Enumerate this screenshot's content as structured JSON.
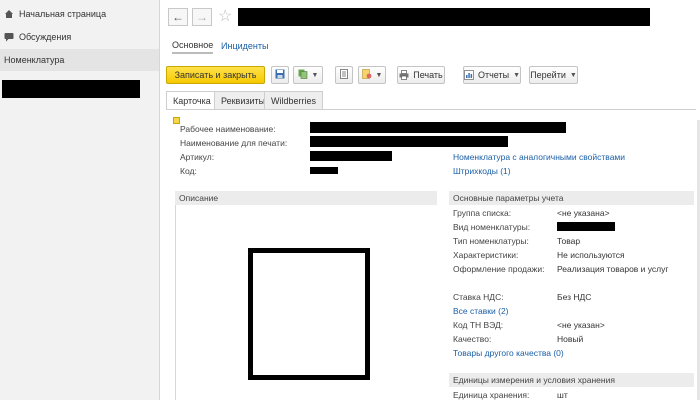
{
  "sidebar": {
    "items": [
      {
        "label": "Начальная страница",
        "icon": "home-icon"
      },
      {
        "label": "Обсуждения",
        "icon": "chat-icon"
      },
      {
        "label": "Номенклатура",
        "icon": ""
      }
    ]
  },
  "header": {
    "back_icon": "arrow-left-icon",
    "forward_icon": "arrow-right-icon",
    "favorite_icon": "star-icon"
  },
  "section_tabs": [
    "Основное",
    "Инциденты"
  ],
  "toolbar": {
    "save_close": "Записать и закрыть",
    "print": "Печать",
    "reports": "Отчеты",
    "goto": "Перейти"
  },
  "form_tabs": [
    "Карточка",
    "Реквизиты",
    "Wildberries"
  ],
  "fields": {
    "work_name": "Рабочее наименование:",
    "print_name": "Наименование для печати:",
    "article": "Артикул:",
    "code": "Код:",
    "analog_link": "Номенклатура с аналогичными свойствами",
    "barcodes_link": "Штрихкоды (1)"
  },
  "description": {
    "header": "Описание"
  },
  "accounting": {
    "header": "Основные параметры учета",
    "rows": [
      {
        "label": "Группа списка:",
        "value": "<не указана>"
      },
      {
        "label": "Вид номенклатуры:",
        "value": ""
      },
      {
        "label": "Тип номенклатуры:",
        "value": "Товар"
      },
      {
        "label": "Характеристики:",
        "value": "Не используются"
      },
      {
        "label": "Оформление продажи:",
        "value": "Реализация товаров и услуг"
      }
    ],
    "vat_label": "Ставка НДС:",
    "vat_value": "Без НДС",
    "all_rates_link": "Все ставки (2)",
    "tn_ved_label": "Код ТН ВЭД:",
    "tn_ved_value": "<не указан>",
    "quality_label": "Качество:",
    "quality_value": "Новый",
    "other_quality_link": "Товары другого качества (0)"
  },
  "storage": {
    "header": "Единицы измерения и условия хранения",
    "unit_label": "Единица хранения:",
    "unit_value": "шт"
  },
  "colors": {
    "primary_button": "#f6c900",
    "link": "#1a5fa6",
    "sidebar_bg": "#f2f2f2"
  }
}
